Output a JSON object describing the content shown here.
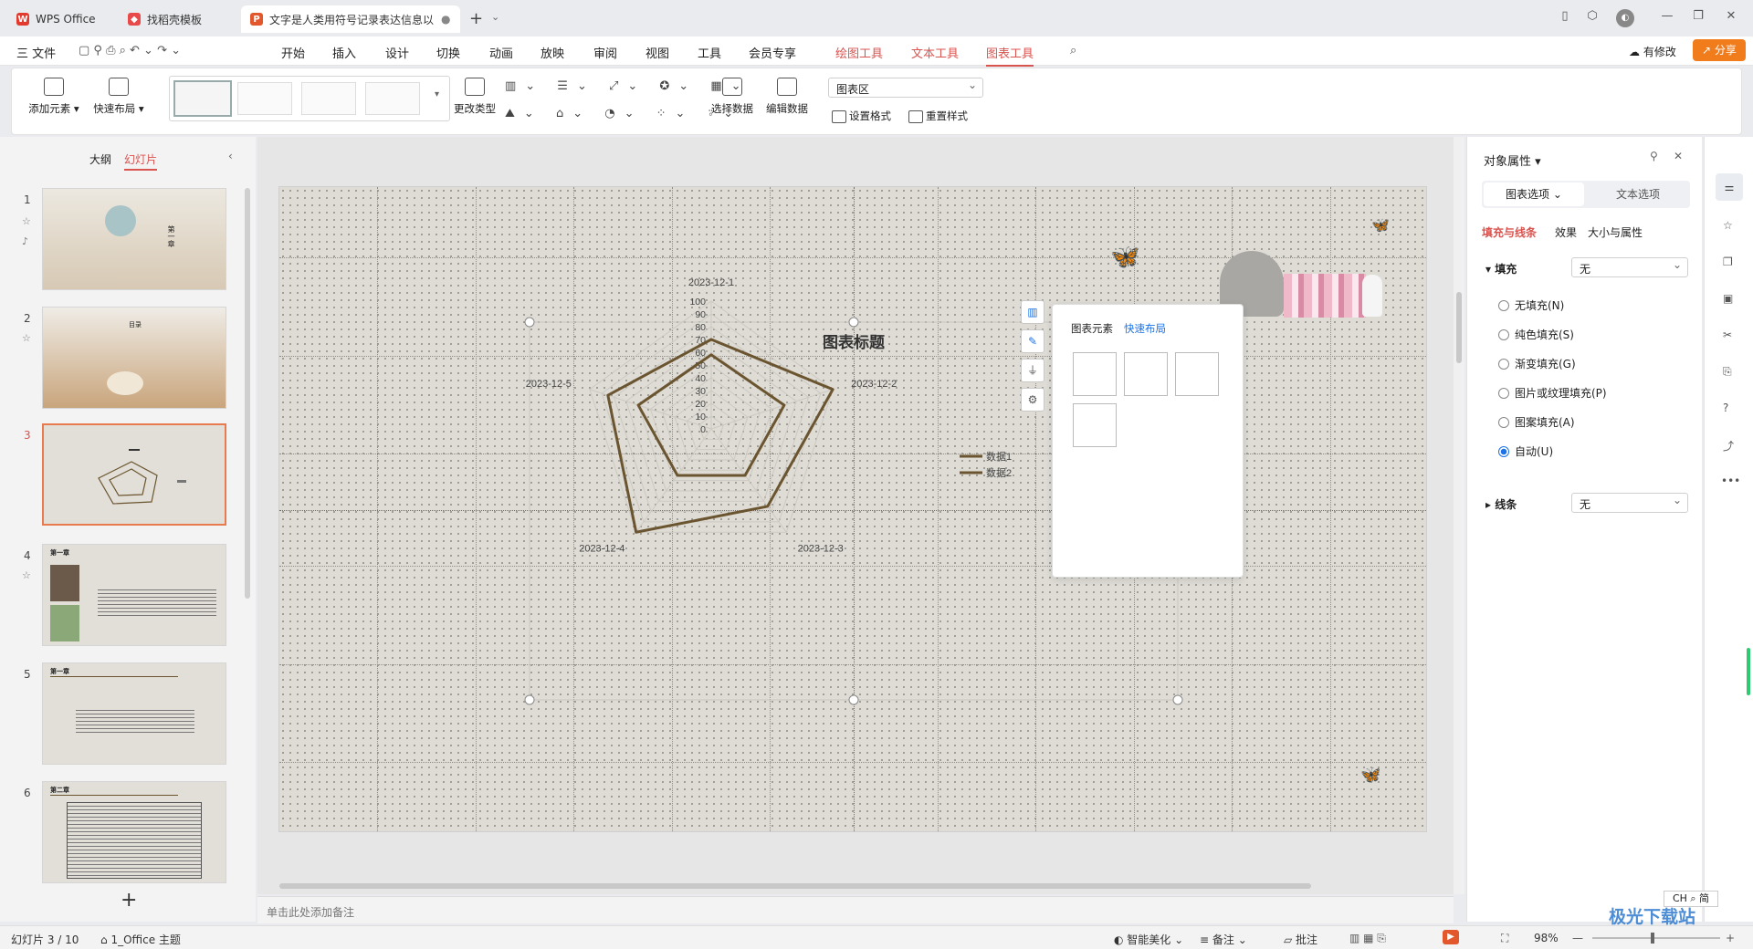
{
  "titlebar": {
    "tabs": [
      {
        "label": "WPS Office",
        "icon": "wps-logo-icon"
      },
      {
        "label": "找稻壳模板",
        "icon": "docer-icon"
      },
      {
        "label": "文字是人类用符号记录表达信息以",
        "icon": "ppt-file-icon"
      }
    ],
    "new_tab": "+"
  },
  "menubar": {
    "file": "三 文件",
    "items": [
      "开始",
      "插入",
      "设计",
      "切换",
      "动画",
      "放映",
      "审阅",
      "视图",
      "工具",
      "会员专享"
    ],
    "context": [
      "绘图工具",
      "文本工具",
      "图表工具"
    ],
    "has_changes": "有修改",
    "share": "分享"
  },
  "ribbon": {
    "add_element": "添加元素",
    "quick_layout": "快速布局",
    "change_type": "更改类型",
    "select_data": "选择数据",
    "edit_data": "编辑数据",
    "chart_area_select": "图表区",
    "set_format": "设置格式",
    "reset_style": "重置样式"
  },
  "leftpanel": {
    "tab_outline": "大纲",
    "tab_slides": "幻灯片",
    "slides": [
      {
        "num": "1",
        "title": "第一章"
      },
      {
        "num": "2",
        "title": "目录"
      },
      {
        "num": "3",
        "title": ""
      },
      {
        "num": "4",
        "title": "第一章"
      },
      {
        "num": "5",
        "title": "第一章"
      },
      {
        "num": "6",
        "title": "第二章"
      }
    ],
    "add": "+"
  },
  "slide": {
    "notes_placeholder": "单击此处添加备注"
  },
  "chart_data": {
    "type": "radar",
    "title": "图表标题",
    "categories": [
      "2023-12-1",
      "2023-12-2",
      "2023-12-3",
      "2023-12-4",
      "2023-12-5"
    ],
    "ticks": [
      "100",
      "90",
      "80",
      "70",
      "60",
      "50",
      "40",
      "30",
      "20",
      "10",
      "0"
    ],
    "series": [
      {
        "name": "数据1",
        "values": [
          70,
          100,
          75,
          100,
          85
        ]
      },
      {
        "name": "数据2",
        "values": [
          58,
          60,
          45,
          45,
          60
        ]
      }
    ],
    "rmax": 100,
    "line_color": "#6b5530",
    "legend": "right"
  },
  "chart_popup": {
    "tab_elements": "图表元素",
    "tab_layout": "快速布局"
  },
  "rightpanel": {
    "title": "对象属性",
    "tab_chart": "图表选项",
    "tab_text": "文本选项",
    "subtabs": [
      "填充与线条",
      "效果",
      "大小与属性"
    ],
    "fill_label": "填充",
    "fill_value": "无",
    "options": [
      "无填充(N)",
      "纯色填充(S)",
      "渐变填充(G)",
      "图片或纹理填充(P)",
      "图案填充(A)",
      "自动(U)"
    ],
    "selected": "自动(U)",
    "line_label": "线条",
    "line_value": "无"
  },
  "statusbar": {
    "slide_pos": "幻灯片 3 / 10",
    "theme": "1_Office 主题",
    "beautify": "智能美化",
    "notes": "备注",
    "comments": "批注",
    "zoom": "98%",
    "ime": "CH ⌕ 简"
  },
  "watermark": "极光下载站"
}
